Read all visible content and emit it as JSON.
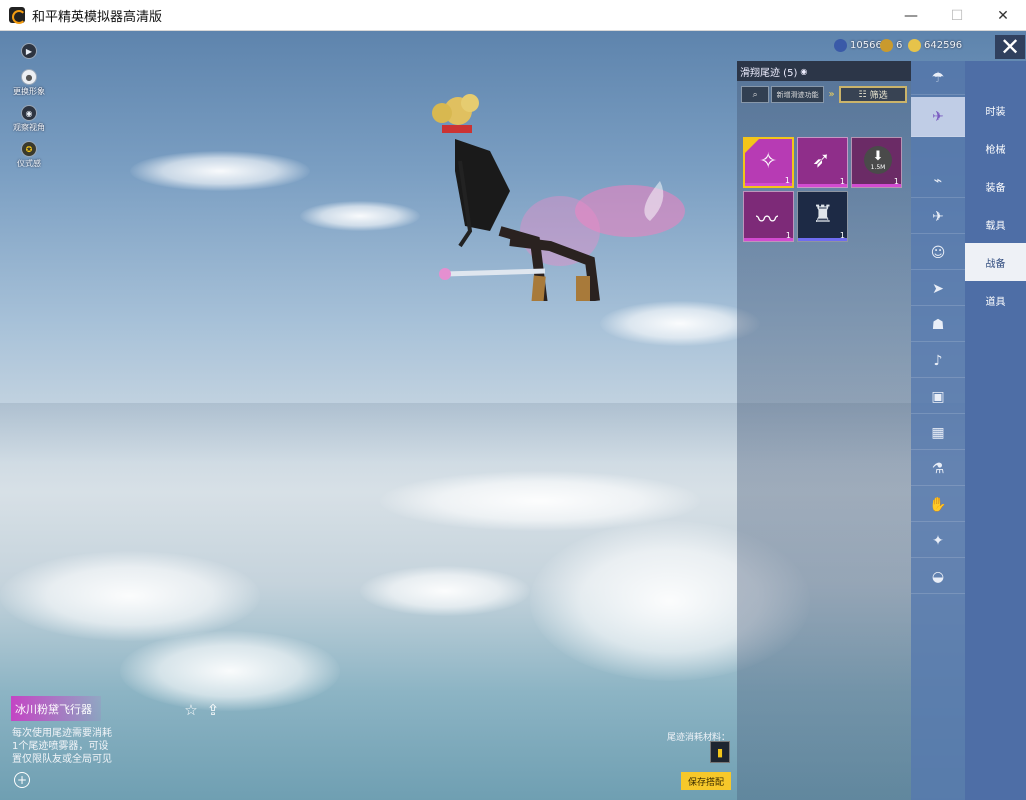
{
  "window": {
    "title": "和平精英模拟器高清版",
    "minimize": "—",
    "maximize": "☐",
    "close": "✕"
  },
  "left_icons": [
    {
      "icon": "play-icon",
      "glyph": "▶",
      "label": ""
    },
    {
      "icon": "avatar-icon",
      "glyph": "●",
      "label": "更换形象"
    },
    {
      "icon": "eye-icon",
      "glyph": "◉",
      "label": "观察视角"
    },
    {
      "icon": "emblem-icon",
      "glyph": "✪",
      "label": "仪式感"
    }
  ],
  "currency": [
    {
      "icon": "coin-icon",
      "value": "10566",
      "color": "#3a5aa8"
    },
    {
      "icon": "medal-icon",
      "value": "6",
      "color": "#c99a2e"
    },
    {
      "icon": "shield-coin-icon",
      "value": "642596",
      "color": "#e6c34a"
    }
  ],
  "panel": {
    "title": "滑翔尾迹 (5)",
    "title_icon": "◉",
    "search_glyph": "⌕",
    "filter_label": "新增滑迹功能",
    "arrow": "»",
    "screen_label": "筛选",
    "screen_icon": "☷"
  },
  "items": [
    {
      "name": "wand-item",
      "count": "1",
      "color": "#b73bb4",
      "bar": "#d24bd1",
      "selected": true,
      "glyph": "✧"
    },
    {
      "name": "wing-item",
      "count": "1",
      "color": "#8f2e8a",
      "bar": "#d24bd1",
      "selected": false,
      "glyph": "➶"
    },
    {
      "name": "download-item",
      "count": "1",
      "color": "#6b2b66",
      "bar": "#d24bd1",
      "selected": false,
      "glyph": "⬇",
      "size": "1.5M"
    },
    {
      "name": "feather-item",
      "count": "1",
      "color": "#7d2a78",
      "bar": "#d24bd1",
      "selected": false,
      "glyph": "〰"
    },
    {
      "name": "robot-item",
      "count": "1",
      "color": "#1d2a45",
      "bar": "#6f6cf0",
      "selected": false,
      "glyph": "♜"
    }
  ],
  "categories": [
    {
      "icon": "parachute-icon",
      "glyph": "☂"
    },
    {
      "icon": "glider-icon",
      "glyph": "✈",
      "selected": true
    },
    {
      "icon": "drone-icon",
      "glyph": "⌁"
    },
    {
      "icon": "plane-icon",
      "glyph": "✈"
    },
    {
      "icon": "emote-icon",
      "glyph": "☺"
    },
    {
      "icon": "jet-icon",
      "glyph": "➤"
    },
    {
      "icon": "robot-icon",
      "glyph": "☗"
    },
    {
      "icon": "sound-icon",
      "glyph": "♪"
    },
    {
      "icon": "card-icon",
      "glyph": "▣"
    },
    {
      "icon": "picture-icon",
      "glyph": "▦"
    },
    {
      "icon": "spray-icon",
      "glyph": "⚗"
    },
    {
      "icon": "hand-icon",
      "glyph": "✋"
    },
    {
      "icon": "wand-icon",
      "glyph": "✦"
    },
    {
      "icon": "ufo-icon",
      "glyph": "◒"
    }
  ],
  "tabs": [
    {
      "label": "时装",
      "selected": false
    },
    {
      "label": "枪械",
      "selected": false
    },
    {
      "label": "装备",
      "selected": false
    },
    {
      "label": "载具",
      "selected": false
    },
    {
      "label": "战备",
      "selected": true
    },
    {
      "label": "道具",
      "selected": false
    }
  ],
  "close_glyph": "✕",
  "item_detail": {
    "name": "冰川粉黛飞行器",
    "desc_lines": [
      "每次使用尾迹需要消耗",
      "1个尾迹喷雾器，可设",
      "置仅限队友或全局可见"
    ],
    "star_glyph": "☆",
    "share_glyph": "⇪",
    "zoom_glyph": "+"
  },
  "material": {
    "label": "尾迹消耗材料：",
    "glyph": "▮"
  },
  "save_label": "保存搭配"
}
